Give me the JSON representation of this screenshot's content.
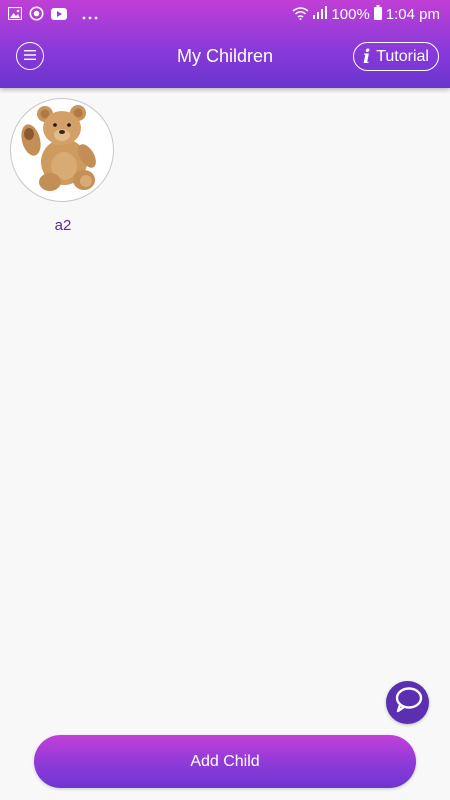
{
  "status_bar": {
    "battery": "100%",
    "time": "1:04 pm",
    "icons": [
      "image-icon",
      "sync-icon",
      "youtube-icon",
      "more-dots-icon",
      "wifi-icon",
      "signal-icon",
      "battery-icon"
    ]
  },
  "header": {
    "title": "My Children",
    "menu_icon": "menu-icon",
    "tutorial_label": "Tutorial",
    "tutorial_icon": "info-icon"
  },
  "children": [
    {
      "name": "a2",
      "avatar": "teddy-bear"
    }
  ],
  "chat_icon": "chat-icon",
  "footer": {
    "add_child_label": "Add Child"
  },
  "colors": {
    "header_gradient_top": "#c03fd6",
    "header_gradient_bottom": "#6a35d0",
    "child_name": "#5a2aa0",
    "chat_fab": "#5b2fb0",
    "background": "#f8f8f8"
  }
}
